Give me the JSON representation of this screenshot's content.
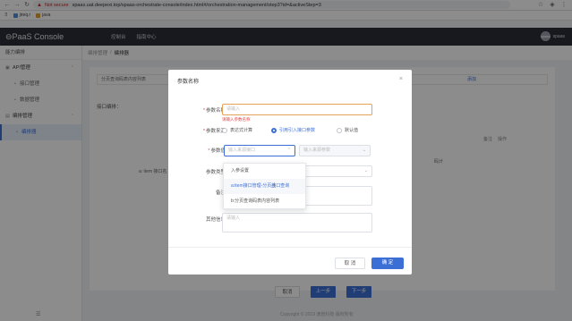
{
  "browser": {
    "not_secure": "Not secure",
    "url_host": "spaas.uat.deepexi.top",
    "url_path": "/spaas-orchestrate-console/index.html#/orchestration-management/step3?id=&activeStep=3",
    "bookmarks": [
      "jireq.r",
      "java"
    ]
  },
  "app": {
    "logo": "⊖PaaS Console",
    "nav": [
      "控制台",
      "指南中心"
    ],
    "user": "spaas",
    "avatar_text": "spaas"
  },
  "sidebar": {
    "title": "能力编排",
    "items": [
      {
        "label": "API管理"
      },
      {
        "label": "接口管理"
      },
      {
        "label": "数据管理"
      },
      {
        "label": "编排管理"
      },
      {
        "label": "编排器"
      }
    ]
  },
  "breadcrumb": {
    "parent": "编排管理",
    "sep": "/",
    "current": "编排器"
  },
  "panel": {
    "row_text": "分页查询码表内容列表",
    "link": "添加",
    "label": "接口编排：",
    "table_headers": [
      "备注",
      "操作"
    ],
    "cell_text": "码计",
    "cell2_text": "a: item 接口名"
  },
  "page_buttons": {
    "cancel": "取消",
    "prev": "上一步",
    "next": "下一步"
  },
  "copyright": "Copyright © 2019 滴普科技 版权所有",
  "modal": {
    "title": "参数名称",
    "close": "×",
    "fields": {
      "name": {
        "label": "参数名称",
        "placeholder": "请输入",
        "error": "请输入参数名称"
      },
      "source": {
        "label": "参数来源",
        "options": [
          "表达式计算",
          "引用引入接口参数",
          "默认值"
        ],
        "selected_index": 1
      },
      "value": {
        "label": "参数值",
        "placeholder_left": "输入来源接口",
        "placeholder_right": "输入来源参数"
      },
      "type": {
        "label": "参数类型"
      },
      "remark": {
        "label": "备注"
      },
      "other": {
        "label": "其他信息",
        "placeholder": "请输入"
      }
    },
    "dropdown": [
      "入参设置",
      "a:item接口管理-分页接口查询",
      "b:分页查询码表内容列表"
    ],
    "cancel": "取 消",
    "ok": "确 定"
  },
  "colors": {
    "primary": "#3c6fd6",
    "header": "#2b2f3a",
    "error": "#e54545"
  }
}
